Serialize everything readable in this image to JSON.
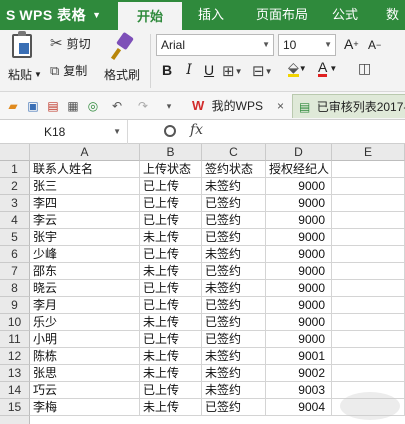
{
  "app": {
    "name": "WPS 表格"
  },
  "tabs": [
    "开始",
    "插入",
    "页面布局",
    "公式",
    "数"
  ],
  "ribbon": {
    "paste": "粘贴",
    "cut": "剪切",
    "copy": "复制",
    "format_painter": "格式刷",
    "font": "Arial",
    "size": "10",
    "bold": "B",
    "italic": "I",
    "underline": "U"
  },
  "doc_tabs": {
    "home": "我的WPS",
    "current": "已审核列表2017-"
  },
  "formula_bar": {
    "cell_ref": "K18",
    "fx": "fx"
  },
  "grid": {
    "columns": [
      "A",
      "B",
      "C",
      "D",
      "E"
    ],
    "rows": [
      {
        "n": "1",
        "a": "联系人姓名",
        "b": "上传状态",
        "c": "签约状态",
        "d": "授权经纪人"
      },
      {
        "n": "2",
        "a": "张三",
        "b": "已上传",
        "c": "未签约",
        "d": "9000"
      },
      {
        "n": "3",
        "a": "李四",
        "b": "已上传",
        "c": "已签约",
        "d": "9000"
      },
      {
        "n": "4",
        "a": "李云",
        "b": "已上传",
        "c": "已签约",
        "d": "9000"
      },
      {
        "n": "5",
        "a": "张宇",
        "b": "未上传",
        "c": "已签约",
        "d": "9000"
      },
      {
        "n": "6",
        "a": "少峰",
        "b": "已上传",
        "c": "未签约",
        "d": "9000"
      },
      {
        "n": "7",
        "a": "邵东",
        "b": "未上传",
        "c": "已签约",
        "d": "9000"
      },
      {
        "n": "8",
        "a": "晓云",
        "b": "已上传",
        "c": "未签约",
        "d": "9000"
      },
      {
        "n": "9",
        "a": "李月",
        "b": "已上传",
        "c": "已签约",
        "d": "9000"
      },
      {
        "n": "10",
        "a": "乐少",
        "b": "未上传",
        "c": "已签约",
        "d": "9000"
      },
      {
        "n": "11",
        "a": "小明",
        "b": "已上传",
        "c": "已签约",
        "d": "9000"
      },
      {
        "n": "12",
        "a": "陈栋",
        "b": "未上传",
        "c": "未签约",
        "d": "9001"
      },
      {
        "n": "13",
        "a": "张思",
        "b": "未上传",
        "c": "未签约",
        "d": "9002"
      },
      {
        "n": "14",
        "a": "巧云",
        "b": "已上传",
        "c": "未签约",
        "d": "9003"
      },
      {
        "n": "15",
        "a": "李梅",
        "b": "未上传",
        "c": "已签约",
        "d": "9004"
      }
    ]
  },
  "colors": {
    "brand": "#2f8a3c",
    "header_bg": "#eaeaea"
  }
}
